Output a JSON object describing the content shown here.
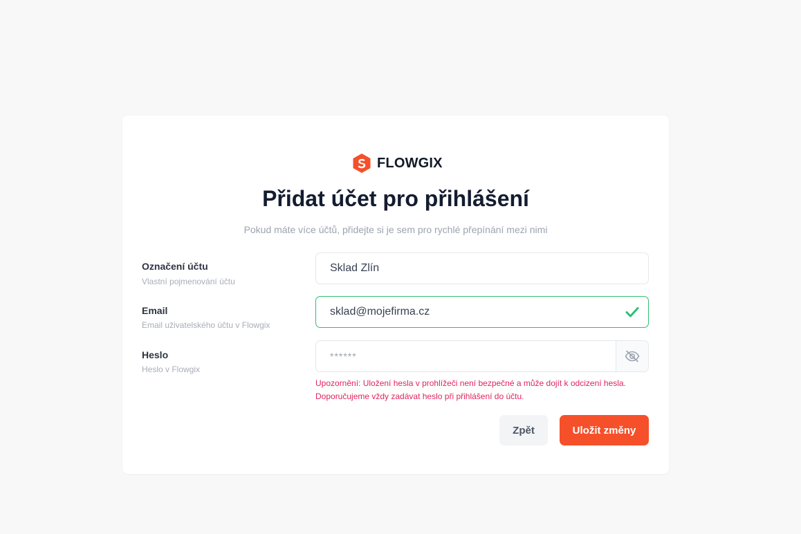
{
  "brand": {
    "name": "FLOWGIX",
    "logo_icon": "hexagon-s-logo-icon",
    "accent_color": "#f5502a"
  },
  "page": {
    "title": "Přidat účet pro přihlášení",
    "subtitle": "Pokud máte více účtů, přidejte si je sem pro rychlé přepínání mezi nimi"
  },
  "form": {
    "account_label": {
      "label": "Označení účtu",
      "hint": "Vlastní pojmenování účtu",
      "value": "Sklad Zlín"
    },
    "email": {
      "label": "Email",
      "hint": "Email uživatelského účtu v Flowgix",
      "value": "sklad@mojefirma.cz",
      "status_icon": "check-icon",
      "valid_color": "#2fbf71"
    },
    "password": {
      "label": "Heslo",
      "hint": "Heslo v Flowgix",
      "value": "******",
      "toggle_icon": "eye-off-icon"
    },
    "warning": "Upozornění: Uložení hesla v prohlížeči není bezpečné a může dojít k odcizení hesla. Doporučujeme vždy zadávat heslo při přihlášení do účtu.",
    "warning_color": "#e0245e"
  },
  "actions": {
    "back_label": "Zpět",
    "save_label": "Uložit změny"
  }
}
